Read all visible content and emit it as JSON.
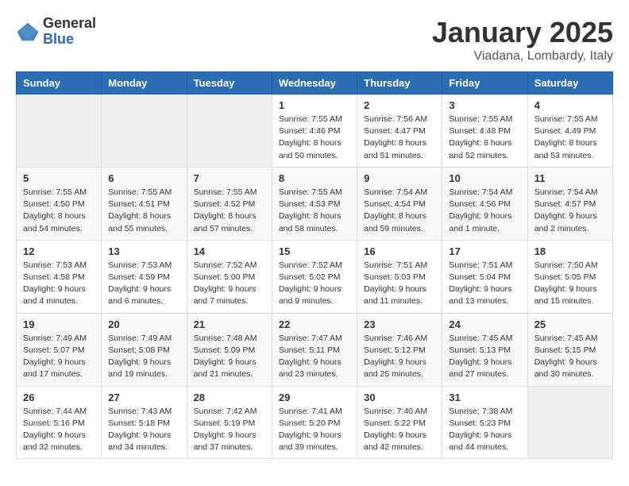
{
  "logo": {
    "general": "General",
    "blue": "Blue"
  },
  "title": "January 2025",
  "subtitle": "Viadana, Lombardy, Italy",
  "weekdays": [
    "Sunday",
    "Monday",
    "Tuesday",
    "Wednesday",
    "Thursday",
    "Friday",
    "Saturday"
  ],
  "weeks": [
    [
      {
        "day": "",
        "info": ""
      },
      {
        "day": "",
        "info": ""
      },
      {
        "day": "",
        "info": ""
      },
      {
        "day": "1",
        "info": "Sunrise: 7:55 AM\nSunset: 4:46 PM\nDaylight: 8 hours\nand 50 minutes."
      },
      {
        "day": "2",
        "info": "Sunrise: 7:56 AM\nSunset: 4:47 PM\nDaylight: 8 hours\nand 51 minutes."
      },
      {
        "day": "3",
        "info": "Sunrise: 7:55 AM\nSunset: 4:48 PM\nDaylight: 8 hours\nand 52 minutes."
      },
      {
        "day": "4",
        "info": "Sunrise: 7:55 AM\nSunset: 4:49 PM\nDaylight: 8 hours\nand 53 minutes."
      }
    ],
    [
      {
        "day": "5",
        "info": "Sunrise: 7:55 AM\nSunset: 4:50 PM\nDaylight: 8 hours\nand 54 minutes."
      },
      {
        "day": "6",
        "info": "Sunrise: 7:55 AM\nSunset: 4:51 PM\nDaylight: 8 hours\nand 55 minutes."
      },
      {
        "day": "7",
        "info": "Sunrise: 7:55 AM\nSunset: 4:52 PM\nDaylight: 8 hours\nand 57 minutes."
      },
      {
        "day": "8",
        "info": "Sunrise: 7:55 AM\nSunset: 4:53 PM\nDaylight: 8 hours\nand 58 minutes."
      },
      {
        "day": "9",
        "info": "Sunrise: 7:54 AM\nSunset: 4:54 PM\nDaylight: 8 hours\nand 59 minutes."
      },
      {
        "day": "10",
        "info": "Sunrise: 7:54 AM\nSunset: 4:56 PM\nDaylight: 9 hours\nand 1 minute."
      },
      {
        "day": "11",
        "info": "Sunrise: 7:54 AM\nSunset: 4:57 PM\nDaylight: 9 hours\nand 2 minutes."
      }
    ],
    [
      {
        "day": "12",
        "info": "Sunrise: 7:53 AM\nSunset: 4:58 PM\nDaylight: 9 hours\nand 4 minutes."
      },
      {
        "day": "13",
        "info": "Sunrise: 7:53 AM\nSunset: 4:59 PM\nDaylight: 9 hours\nand 6 minutes."
      },
      {
        "day": "14",
        "info": "Sunrise: 7:52 AM\nSunset: 5:00 PM\nDaylight: 9 hours\nand 7 minutes."
      },
      {
        "day": "15",
        "info": "Sunrise: 7:52 AM\nSunset: 5:02 PM\nDaylight: 9 hours\nand 9 minutes."
      },
      {
        "day": "16",
        "info": "Sunrise: 7:51 AM\nSunset: 5:03 PM\nDaylight: 9 hours\nand 11 minutes."
      },
      {
        "day": "17",
        "info": "Sunrise: 7:51 AM\nSunset: 5:04 PM\nDaylight: 9 hours\nand 13 minutes."
      },
      {
        "day": "18",
        "info": "Sunrise: 7:50 AM\nSunset: 5:05 PM\nDaylight: 9 hours\nand 15 minutes."
      }
    ],
    [
      {
        "day": "19",
        "info": "Sunrise: 7:49 AM\nSunset: 5:07 PM\nDaylight: 9 hours\nand 17 minutes."
      },
      {
        "day": "20",
        "info": "Sunrise: 7:49 AM\nSunset: 5:08 PM\nDaylight: 9 hours\nand 19 minutes."
      },
      {
        "day": "21",
        "info": "Sunrise: 7:48 AM\nSunset: 5:09 PM\nDaylight: 9 hours\nand 21 minutes."
      },
      {
        "day": "22",
        "info": "Sunrise: 7:47 AM\nSunset: 5:11 PM\nDaylight: 9 hours\nand 23 minutes."
      },
      {
        "day": "23",
        "info": "Sunrise: 7:46 AM\nSunset: 5:12 PM\nDaylight: 9 hours\nand 25 minutes."
      },
      {
        "day": "24",
        "info": "Sunrise: 7:45 AM\nSunset: 5:13 PM\nDaylight: 9 hours\nand 27 minutes."
      },
      {
        "day": "25",
        "info": "Sunrise: 7:45 AM\nSunset: 5:15 PM\nDaylight: 9 hours\nand 30 minutes."
      }
    ],
    [
      {
        "day": "26",
        "info": "Sunrise: 7:44 AM\nSunset: 5:16 PM\nDaylight: 9 hours\nand 32 minutes."
      },
      {
        "day": "27",
        "info": "Sunrise: 7:43 AM\nSunset: 5:18 PM\nDaylight: 9 hours\nand 34 minutes."
      },
      {
        "day": "28",
        "info": "Sunrise: 7:42 AM\nSunset: 5:19 PM\nDaylight: 9 hours\nand 37 minutes."
      },
      {
        "day": "29",
        "info": "Sunrise: 7:41 AM\nSunset: 5:20 PM\nDaylight: 9 hours\nand 39 minutes."
      },
      {
        "day": "30",
        "info": "Sunrise: 7:40 AM\nSunset: 5:22 PM\nDaylight: 9 hours\nand 42 minutes."
      },
      {
        "day": "31",
        "info": "Sunrise: 7:38 AM\nSunset: 5:23 PM\nDaylight: 9 hours\nand 44 minutes."
      },
      {
        "day": "",
        "info": ""
      }
    ]
  ]
}
